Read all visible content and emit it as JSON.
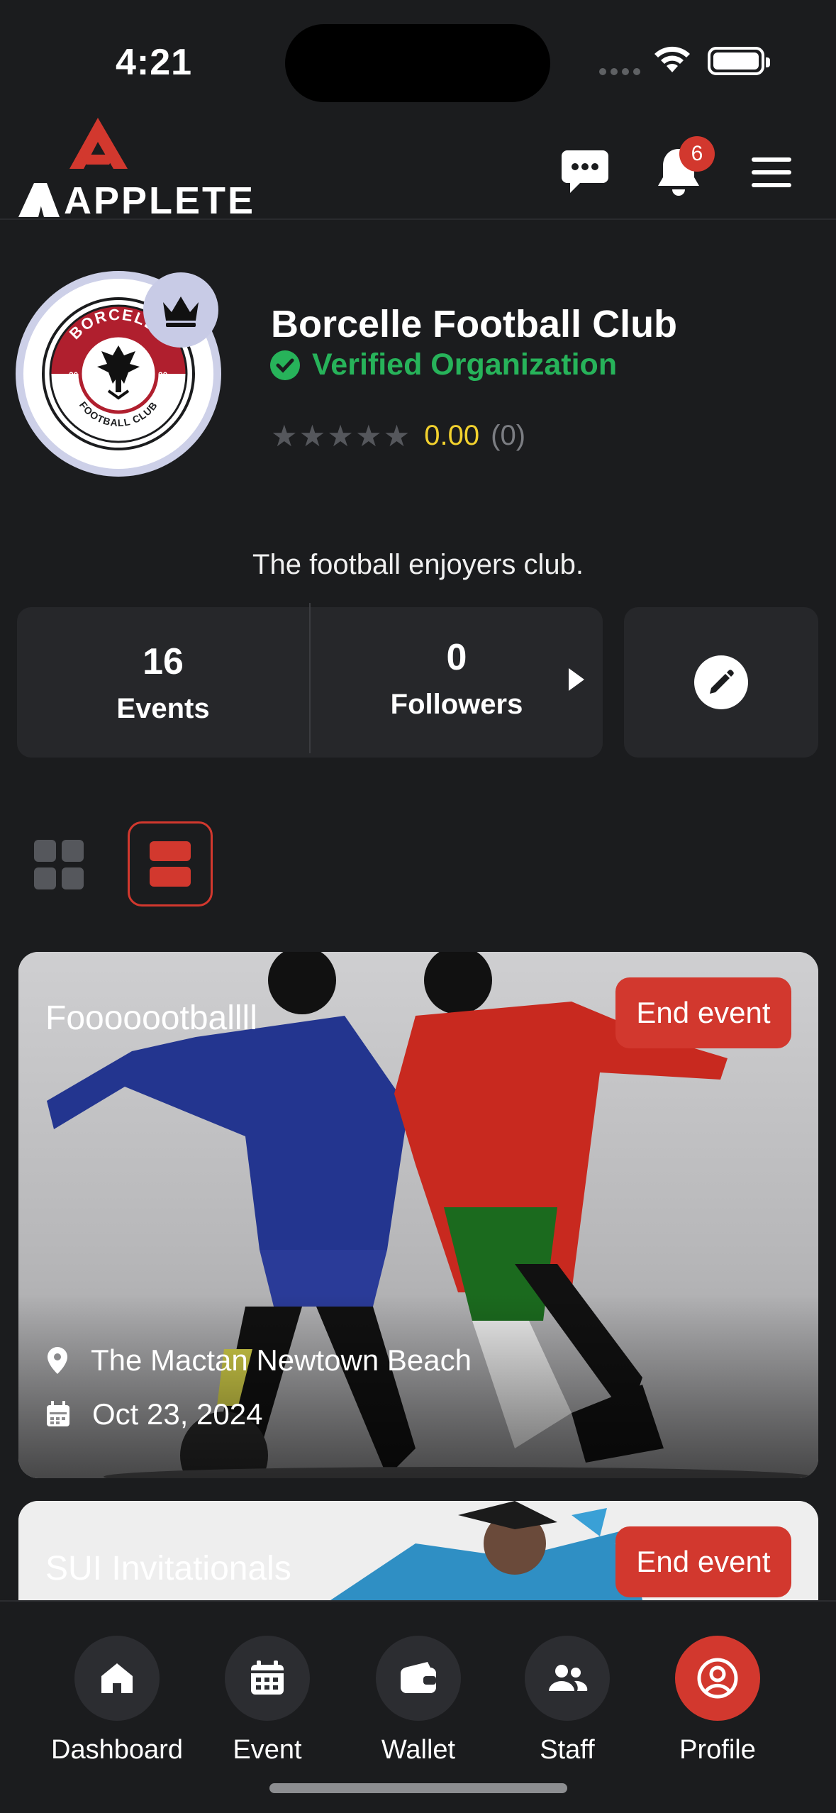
{
  "status_bar": {
    "time": "4:21"
  },
  "header": {
    "logo_text": "APPLETE",
    "notification_count": "6",
    "icons": [
      "chat-icon",
      "bell-icon",
      "menu-icon"
    ]
  },
  "profile": {
    "name": "Borcelle Football Club",
    "verified_label": "Verified Organization",
    "rating_value": "0.00",
    "rating_count": "(0)",
    "stars": "★★★★★",
    "crest_top": "BORCELLE",
    "crest_bottom": "FOOTBALL CLUB",
    "crest_year_left": "20",
    "crest_year_right": "20",
    "bio": "The football enjoyers club."
  },
  "stats": {
    "events_count": "16",
    "events_label": "Events",
    "followers_count": "0",
    "followers_label": "Followers"
  },
  "events": [
    {
      "title": "Fooooootballll",
      "action": "End event",
      "location": "The Mactan Newtown Beach",
      "date": "Oct 23, 2024"
    },
    {
      "title": "SUI Invitationals",
      "action": "End event"
    }
  ],
  "nav": {
    "items": [
      {
        "label": "Dashboard",
        "icon": "home-icon"
      },
      {
        "label": "Event",
        "icon": "calendar-icon"
      },
      {
        "label": "Wallet",
        "icon": "wallet-icon"
      },
      {
        "label": "Staff",
        "icon": "people-icon"
      },
      {
        "label": "Profile",
        "icon": "profile-icon"
      }
    ],
    "active": "Profile"
  },
  "colors": {
    "background": "#1b1c1e",
    "accent": "#d2382e",
    "verified": "#27b35a",
    "rating": "#f2d12e",
    "card": "#26272a"
  }
}
